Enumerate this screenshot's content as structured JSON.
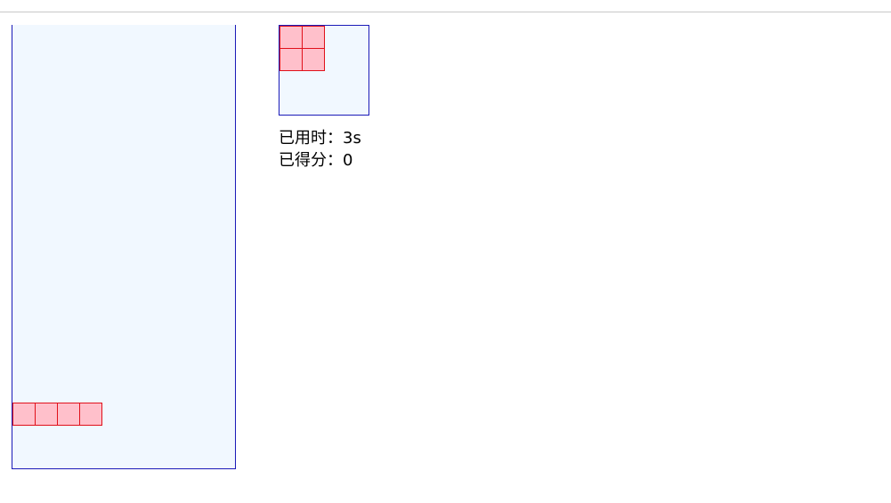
{
  "stats": {
    "time_label": "已用时：",
    "time_value": "3s",
    "score_label": "已得分：",
    "score_value": "0"
  },
  "colors": {
    "board_bg": "#f1f8ff",
    "board_border": "#1a1ab8",
    "block_fill": "#ffc0cb",
    "block_border": "#e0101a"
  },
  "board": {
    "columns": 10,
    "rows": 20,
    "filled_cells": [
      [
        0,
        17
      ],
      [
        1,
        17
      ],
      [
        2,
        17
      ],
      [
        3,
        17
      ]
    ]
  },
  "next_piece": {
    "cells": [
      [
        0,
        0
      ],
      [
        1,
        0
      ],
      [
        0,
        1
      ],
      [
        1,
        1
      ]
    ]
  }
}
